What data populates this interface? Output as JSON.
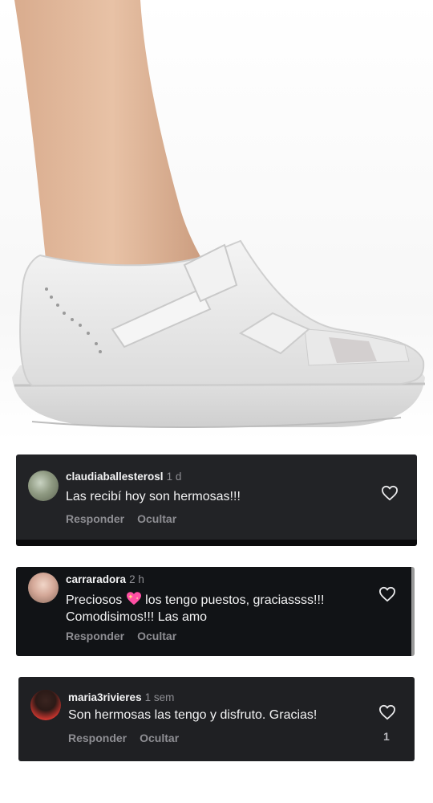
{
  "comments": [
    {
      "username": "claudiaballesterosl",
      "time": "1 d",
      "text": "Las recibí hoy son hermosas!!!",
      "reply_label": "Responder",
      "hide_label": "Ocultar",
      "avatar_icon": "avatar-photo-flowers"
    },
    {
      "username": "carraradora",
      "time": "2 h",
      "text_before_emoji": "Preciosos",
      "emoji_icon": "sparkling-heart-icon",
      "text_after_emoji": "los tengo puestos, graciassss!!! Comodisimos!!! Las amo",
      "reply_label": "Responder",
      "hide_label": "Ocultar",
      "avatar_icon": "avatar-photo-woman"
    },
    {
      "username": "maria3rivieres",
      "time": "1 sem",
      "text": "Son hermosas las tengo y disfruto. Gracias!",
      "reply_label": "Responder",
      "hide_label": "Ocultar",
      "like_count": "1",
      "avatar_icon": "avatar-photo-woman-red"
    }
  ],
  "colors": {
    "card_background": "#1f2023",
    "meta_text": "#8e8e93",
    "primary_text": "#f4f4f5"
  }
}
